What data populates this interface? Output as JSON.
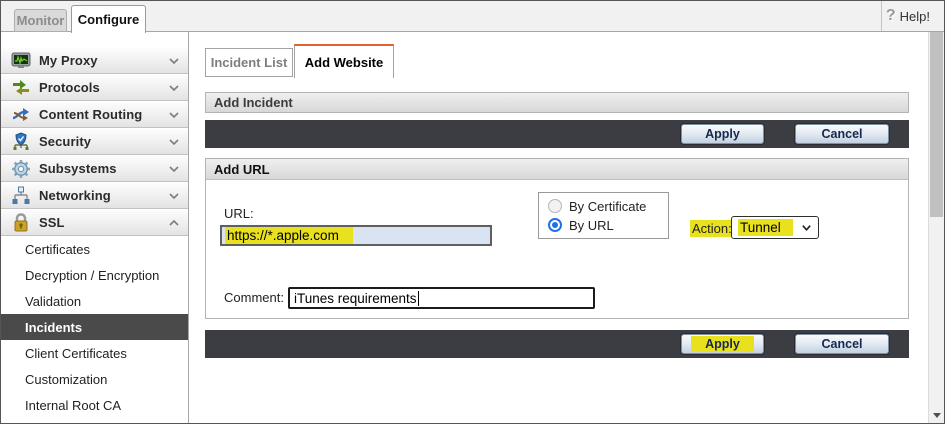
{
  "window": {
    "top_tabs": [
      {
        "label": "Monitor",
        "active": false
      },
      {
        "label": "Configure",
        "active": true
      }
    ],
    "help_label": "Help!",
    "help_icon_glyph": "?"
  },
  "sidebar": {
    "sections": [
      {
        "label": "My Proxy",
        "icon": "monitor-waveform-icon",
        "expanded": false
      },
      {
        "label": "Protocols",
        "icon": "transfer-arrows-icon",
        "expanded": false
      },
      {
        "label": "Content Routing",
        "icon": "shuffle-arrows-icon",
        "expanded": false
      },
      {
        "label": "Security",
        "icon": "shield-icon",
        "expanded": false
      },
      {
        "label": "Subsystems",
        "icon": "gear-icon",
        "expanded": false
      },
      {
        "label": "Networking",
        "icon": "network-tree-icon",
        "expanded": false
      },
      {
        "label": "SSL",
        "icon": "padlock-icon",
        "expanded": true
      }
    ],
    "ssl_items": [
      {
        "label": "Certificates",
        "selected": false
      },
      {
        "label": "Decryption / Encryption",
        "selected": false
      },
      {
        "label": "Validation",
        "selected": false
      },
      {
        "label": "Incidents",
        "selected": true
      },
      {
        "label": "Client Certificates",
        "selected": false
      },
      {
        "label": "Customization",
        "selected": false
      },
      {
        "label": "Internal Root CA",
        "selected": false
      }
    ]
  },
  "main": {
    "tabs": [
      {
        "label": "Incident List",
        "active": false
      },
      {
        "label": "Add Website",
        "active": true
      }
    ],
    "section_title": "Add Incident",
    "toolbar_top": {
      "apply_label": "Apply",
      "cancel_label": "Cancel"
    },
    "add_url": {
      "title": "Add URL",
      "url_label": "URL:",
      "url_value": "https://*.apple.com",
      "url_highlighted": true,
      "radio_options": [
        {
          "label": "By Certificate",
          "selected": false
        },
        {
          "label": "By URL",
          "selected": true
        }
      ],
      "action_label": "Action:",
      "action_value": "Tunnel",
      "action_highlighted": true,
      "comment_label": "Comment:",
      "comment_value": "iTunes requirements"
    },
    "toolbar_bottom": {
      "apply_label": "Apply",
      "cancel_label": "Cancel",
      "apply_highlighted": true
    }
  },
  "colors": {
    "accent_orange": "#e2622b",
    "marker_highlight": "#e9e11d",
    "dark_toolbar": "#3c3c43",
    "selected_nav_bg": "#4a4a4a",
    "url_input_bg": "#dae3f2",
    "radio_blue": "#1d72e8"
  }
}
